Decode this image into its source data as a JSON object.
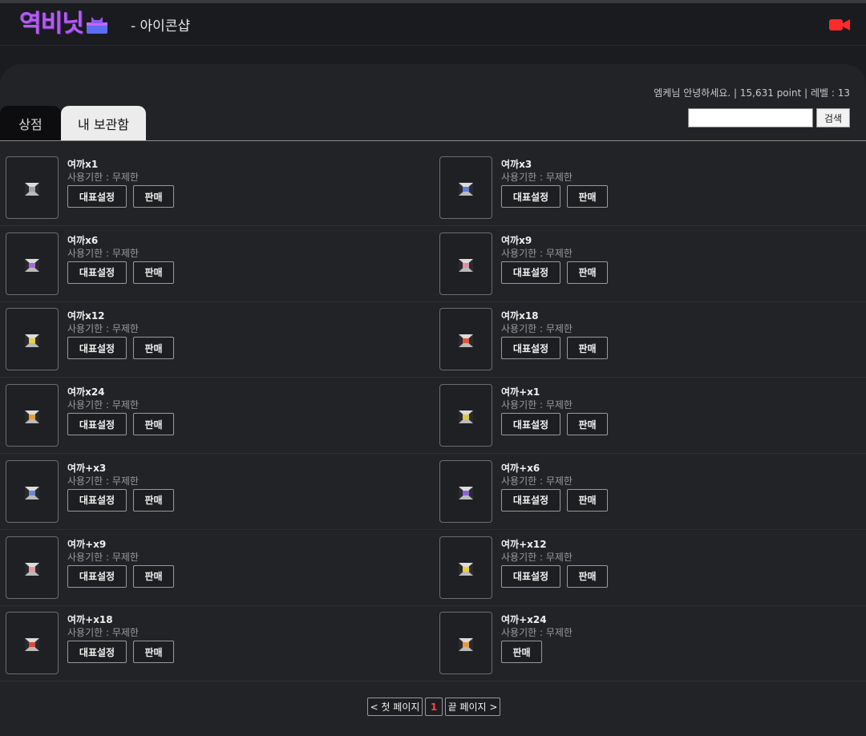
{
  "header": {
    "logo_text": "역비닛",
    "subtitle": "- 아이콘샵",
    "logo_icon": "cat-box-icon",
    "camera_icon": "video-camera-icon",
    "accent_color": "#b25cf2",
    "camera_color": "#ff2a2a"
  },
  "user": {
    "info": "엠케님 안녕하세요. | 15,631 point | 레벨 : 13"
  },
  "search": {
    "value": "",
    "button_label": "검색"
  },
  "tabs": {
    "shop": "상점",
    "mybox": "내 보관함"
  },
  "labels": {
    "represent": "대표설정",
    "sell": "판매"
  },
  "items": [
    {
      "name": "여까x1",
      "expiry": "사용기한 : 무제한",
      "has_rep": true,
      "color": "#9aa3a8"
    },
    {
      "name": "여까x3",
      "expiry": "사용기한 : 무제한",
      "has_rep": true,
      "color": "#5b7fd6"
    },
    {
      "name": "여까x6",
      "expiry": "사용기한 : 무제한",
      "has_rep": true,
      "color": "#a46ad8"
    },
    {
      "name": "여까x9",
      "expiry": "사용기한 : 무제한",
      "has_rep": true,
      "color": "#e48aa6"
    },
    {
      "name": "여까x12",
      "expiry": "사용기한 : 무제한",
      "has_rep": true,
      "color": "#e6d04a"
    },
    {
      "name": "여까x18",
      "expiry": "사용기한 : 무제한",
      "has_rep": true,
      "color": "#e0573a"
    },
    {
      "name": "여까x24",
      "expiry": "사용기한 : 무제한",
      "has_rep": true,
      "color": "#e4a032"
    },
    {
      "name": "여까+x1",
      "expiry": "사용기한 : 무제한",
      "has_rep": true,
      "color": "#d8c84a"
    },
    {
      "name": "여까+x3",
      "expiry": "사용기한 : 무제한",
      "has_rep": true,
      "color": "#6a8ad0"
    },
    {
      "name": "여까+x6",
      "expiry": "사용기한 : 무제한",
      "has_rep": true,
      "color": "#9060d8"
    },
    {
      "name": "여까+x9",
      "expiry": "사용기한 : 무제한",
      "has_rep": true,
      "color": "#e89aa0"
    },
    {
      "name": "여까+x12",
      "expiry": "사용기한 : 무제한",
      "has_rep": true,
      "color": "#f0d030"
    },
    {
      "name": "여까+x18",
      "expiry": "사용기한 : 무제한",
      "has_rep": true,
      "color": "#d84a3a"
    },
    {
      "name": "여까+x24",
      "expiry": "사용기한 : 무제한",
      "has_rep": false,
      "color": "#e89a40"
    }
  ],
  "pagination": {
    "first": "< 첫 페이지",
    "current": "1",
    "last": "끝 페이지 >"
  }
}
